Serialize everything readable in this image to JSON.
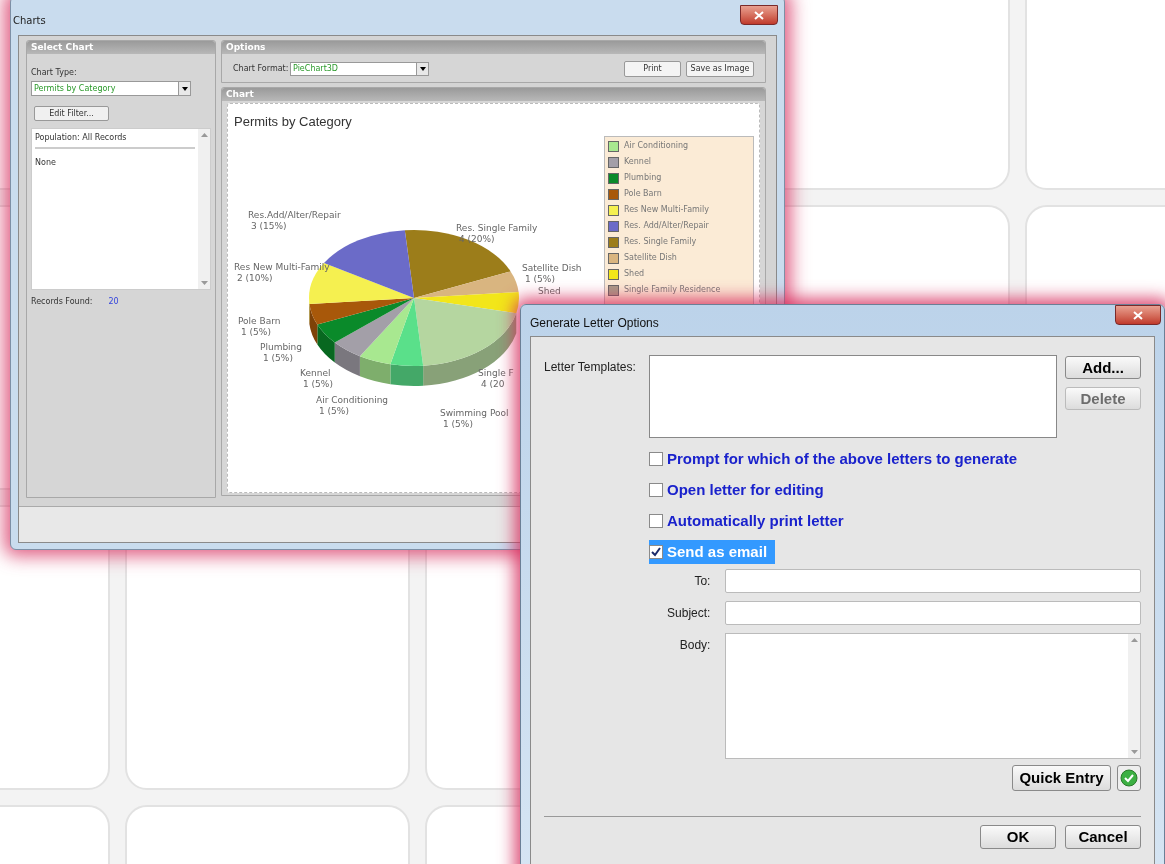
{
  "charts_window": {
    "title": "Charts",
    "select_chart": {
      "header": "Select Chart",
      "chart_type_label": "Chart Type:",
      "chart_type_value": "Permits by Category",
      "edit_filter_button": "Edit Filter...",
      "population": "Population: All Records",
      "filter_items": [
        "None"
      ],
      "records_found_label": "Records Found:",
      "records_found_value": "20"
    },
    "options": {
      "header": "Options",
      "chart_format_label": "Chart Format:",
      "chart_format_value": "PieChart3D",
      "buttons": [
        "Print",
        "Save as Image"
      ]
    },
    "chart_panel": {
      "header": "Chart",
      "chart_title": "Permits by Category",
      "slice_labels": [
        {
          "name": "Res.Add/Alter/Repair",
          "value": "3  (15%)"
        },
        {
          "name": "Res. Single Family",
          "value": "4  (20%)"
        },
        {
          "name": "Res New Multi-Family",
          "value": "2  (10%)"
        },
        {
          "name": "Satellite Dish",
          "value": "1  (5%)"
        },
        {
          "name": "Shed"
        },
        {
          "name": "Pole Barn",
          "value": "1  (5%)"
        },
        {
          "name": "Plumbing",
          "value": "1  (5%)"
        },
        {
          "name": "Kennel",
          "value": "1  (5%)"
        },
        {
          "name": "Single F",
          "value": "4  (20"
        },
        {
          "name": "Air Conditioning",
          "value": "1  (5%)"
        },
        {
          "name": "Swimming Pool",
          "value": "1  (5%)"
        }
      ],
      "legend": [
        {
          "name": "Air Conditioning",
          "color": "#a8e890"
        },
        {
          "name": "Kennel",
          "color": "#a39fa8"
        },
        {
          "name": "Plumbing",
          "color": "#0a8a2a"
        },
        {
          "name": "Pole Barn",
          "color": "#a8580a"
        },
        {
          "name": "Res New Multi-Family",
          "color": "#f5f050"
        },
        {
          "name": "Res. Add/Alter/Repair",
          "color": "#6b6bc8"
        },
        {
          "name": "Res. Single Family",
          "color": "#9c7d1a"
        },
        {
          "name": "Satellite Dish",
          "color": "#d9b580"
        },
        {
          "name": "Shed",
          "color": "#f2e61a"
        },
        {
          "name": "Single Family Residence",
          "color": "#a89a88"
        }
      ]
    }
  },
  "letter_dialog": {
    "title": "Generate Letter Options",
    "templates_label": "Letter Templates:",
    "side_buttons": [
      {
        "label": "Add...",
        "disabled": false
      },
      {
        "label": "Delete",
        "disabled": true
      }
    ],
    "options": [
      {
        "label": "Prompt for which of the above letters to generate",
        "checked": false,
        "selected": false
      },
      {
        "label": "Open letter for editing",
        "checked": false,
        "selected": false
      },
      {
        "label": "Automatically print letter",
        "checked": false,
        "selected": false
      },
      {
        "label": "Send as email",
        "checked": true,
        "selected": true
      }
    ],
    "fields": [
      {
        "label": "To:",
        "kind": "line"
      },
      {
        "label": "Subject:",
        "kind": "line"
      },
      {
        "label": "Body:",
        "kind": "multiline"
      }
    ],
    "quick_entry_button": "Quick Entry",
    "footer_buttons": [
      "OK",
      "Cancel"
    ]
  }
}
